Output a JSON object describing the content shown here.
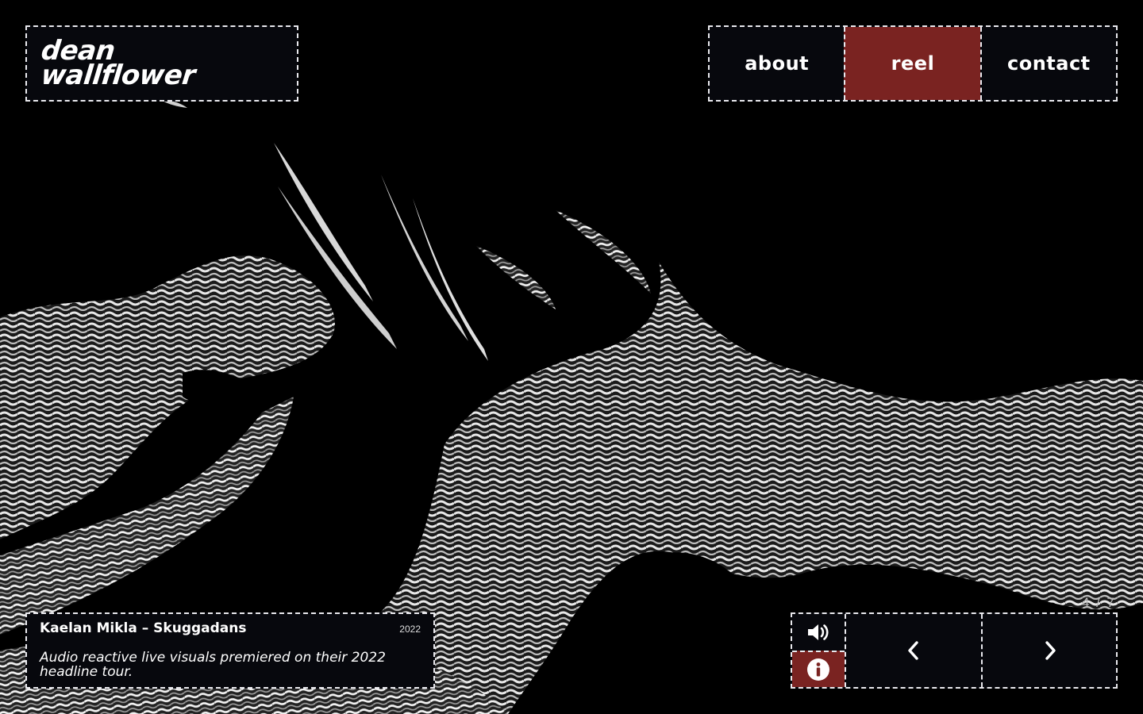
{
  "brand": {
    "line1": "dean",
    "line2": "wallflower"
  },
  "nav": {
    "items": [
      {
        "label": "about",
        "active": false
      },
      {
        "label": "reel",
        "active": true
      },
      {
        "label": "contact",
        "active": false
      }
    ]
  },
  "project": {
    "title": "Kaelan Mikla – Skuggadans",
    "year": "2022",
    "description": "Audio reactive live visuals premiered on their 2022 headline tour."
  },
  "pager": {
    "counter": "4 / 7"
  },
  "controls": {
    "sound_icon": "speaker-icon",
    "info_icon": "info-icon",
    "prev_icon": "chevron-left-icon",
    "next_icon": "chevron-right-icon"
  },
  "colors": {
    "accent": "#7a2321",
    "panel": "#07080d",
    "border": "#e9e9ee",
    "text": "#ffffff"
  }
}
